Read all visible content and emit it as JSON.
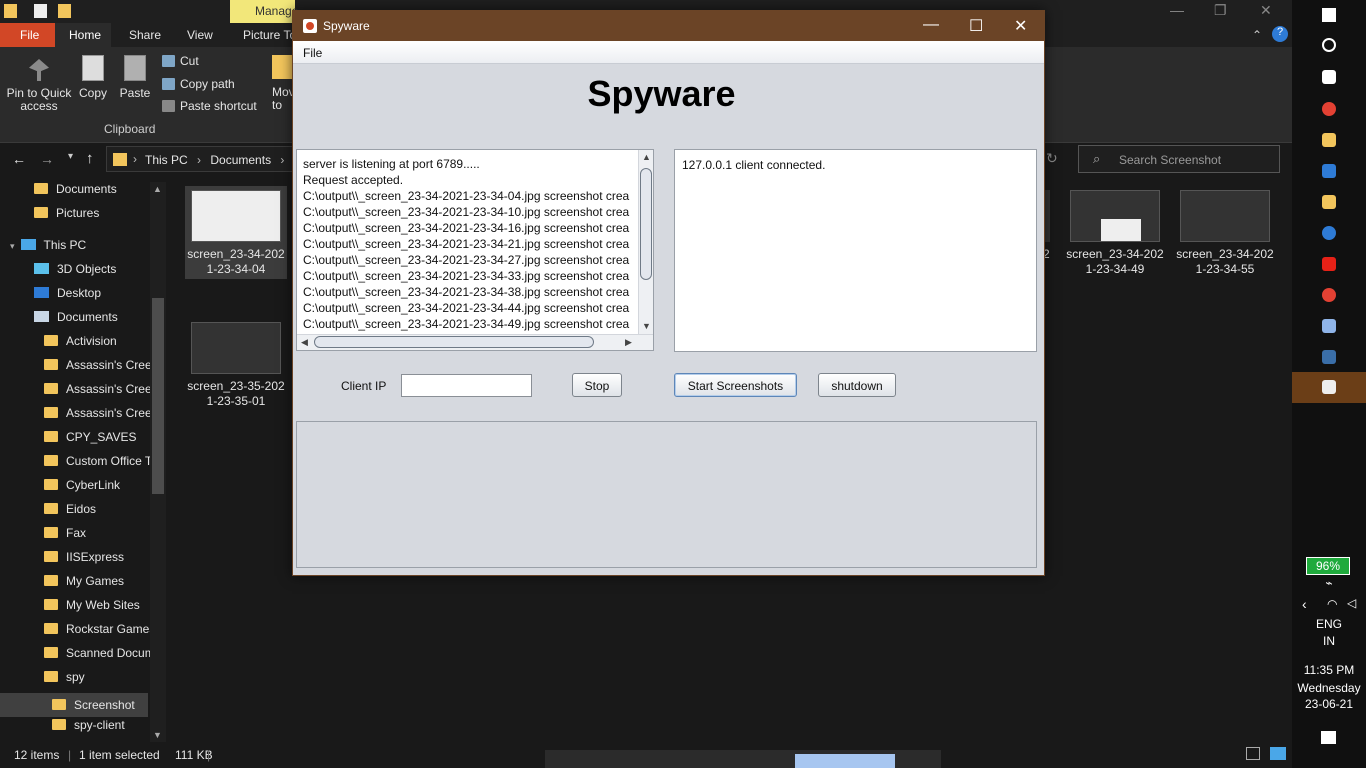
{
  "explorer": {
    "manage_tab": "Manage",
    "ribbon_tabs": [
      "File",
      "Home",
      "Share",
      "View",
      "Picture To"
    ],
    "ribbon": {
      "pin_label": "Pin to Quick access",
      "copy_label": "Copy",
      "paste_label": "Paste",
      "cut_label": "Cut",
      "copy_path_label": "Copy path",
      "paste_shortcut_label": "Paste shortcut",
      "move_label": "Mov to",
      "group_clipboard": "Clipboard"
    },
    "address": {
      "parts": [
        "This PC",
        "Documents"
      ]
    },
    "search_placeholder": "Search Screenshot",
    "nav_items": [
      {
        "label": "Documents",
        "icon": "folder-icon"
      },
      {
        "label": "Pictures",
        "icon": "folder-icon"
      },
      {
        "label": "This PC",
        "icon": "pc-icon"
      },
      {
        "label": "3D Objects",
        "icon": "3d-objects-icon"
      },
      {
        "label": "Desktop",
        "icon": "desktop-icon"
      },
      {
        "label": "Documents",
        "icon": "documents-icon"
      },
      {
        "label": "Activision",
        "icon": "folder-icon"
      },
      {
        "label": "Assassin's Creed",
        "icon": "folder-icon"
      },
      {
        "label": "Assassin's Creed",
        "icon": "folder-icon"
      },
      {
        "label": "Assassin's Creed",
        "icon": "folder-icon"
      },
      {
        "label": "CPY_SAVES",
        "icon": "folder-icon"
      },
      {
        "label": "Custom Office Te",
        "icon": "folder-icon"
      },
      {
        "label": "CyberLink",
        "icon": "folder-icon"
      },
      {
        "label": "Eidos",
        "icon": "folder-icon"
      },
      {
        "label": "Fax",
        "icon": "folder-icon"
      },
      {
        "label": "IISExpress",
        "icon": "folder-icon"
      },
      {
        "label": "My Games",
        "icon": "folder-icon"
      },
      {
        "label": "My Web Sites",
        "icon": "folder-icon"
      },
      {
        "label": "Rockstar Games",
        "icon": "folder-icon"
      },
      {
        "label": "Scanned Docum",
        "icon": "folder-icon"
      },
      {
        "label": "spy",
        "icon": "folder-icon"
      },
      {
        "label": "Screenshot",
        "icon": "folder-icon"
      },
      {
        "label": "spy-client",
        "icon": "folder-icon"
      }
    ],
    "files": [
      {
        "line1": "screen_23-34-202",
        "line2": "1-23-34-04"
      },
      {
        "line1": "screen_23-35-202",
        "line2": "1-23-35-01"
      },
      {
        "line1": "2",
        "line2": ""
      },
      {
        "line1": "screen_23-34-202",
        "line2": "1-23-34-49"
      },
      {
        "line1": "screen_23-34-202",
        "line2": "1-23-34-55"
      }
    ],
    "status": {
      "items": "12 items",
      "selected": "1 item selected",
      "size": "111 KB"
    }
  },
  "taskbar": {
    "battery": "96%",
    "lang1": "ENG",
    "lang2": "IN",
    "time": "11:35 PM",
    "day": "Wednesday",
    "date": "23-06-21"
  },
  "spyware": {
    "window_title": "Spyware",
    "menu_file": "File",
    "heading": "Spyware",
    "log_lines": [
      "server is listening at port 6789.....",
      "Request accepted.",
      "C:\\output\\\\_screen_23-34-2021-23-34-04.jpg screenshot crea",
      "C:\\output\\\\_screen_23-34-2021-23-34-10.jpg screenshot crea",
      "C:\\output\\\\_screen_23-34-2021-23-34-16.jpg screenshot crea",
      "C:\\output\\\\_screen_23-34-2021-23-34-21.jpg screenshot crea",
      "C:\\output\\\\_screen_23-34-2021-23-34-27.jpg screenshot crea",
      "C:\\output\\\\_screen_23-34-2021-23-34-33.jpg screenshot crea",
      "C:\\output\\\\_screen_23-34-2021-23-34-38.jpg screenshot crea",
      "C:\\output\\\\_screen_23-34-2021-23-34-44.jpg screenshot crea",
      "C:\\output\\\\_screen_23-34-2021-23-34-49.jpg screenshot crea"
    ],
    "status_line": "127.0.0.1 client connected.",
    "client_ip_label": "Client IP",
    "client_ip_value": "",
    "btn_stop": "Stop",
    "btn_start": "Start Screenshots",
    "btn_shutdown": "shutdown"
  }
}
